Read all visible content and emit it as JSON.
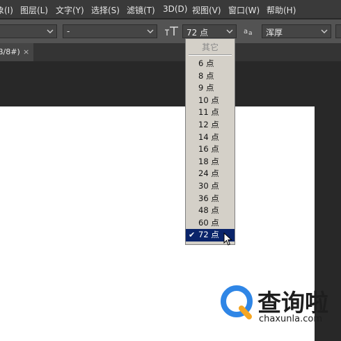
{
  "menubar": {
    "items": [
      "象(I)",
      "图层(L)",
      "文字(Y)",
      "选择(S)",
      "滤镜(T)",
      "3D(D)",
      "视图(V)",
      "窗口(W)",
      "帮助(H)"
    ]
  },
  "options_bar": {
    "font_style_value": "-",
    "font_size_icon": "font-size-icon",
    "font_size_value": "72 点",
    "antialias_icon": "aa-icon",
    "antialias_value": "浑厚"
  },
  "document_tab": {
    "title": "B/8#)",
    "close": "×"
  },
  "font_size_dropdown": {
    "header": "其它",
    "items": [
      "6 点",
      "8 点",
      "9 点",
      "10 点",
      "11 点",
      "12 点",
      "14 点",
      "16 点",
      "18 点",
      "24 点",
      "30 点",
      "36 点",
      "48 点",
      "60 点",
      "72 点"
    ],
    "selected": "72 点",
    "check": "✔"
  },
  "watermark": {
    "title": "查询啦",
    "url": "chaxunla.com"
  },
  "colors": {
    "menubar_bg": "#3a3a3a",
    "options_bg": "#535353",
    "workspace_bg": "#282828",
    "canvas_bg": "#ffffff",
    "dropdown_bg": "#d4d0c8",
    "selection_bg": "#0a246a",
    "logo_blue": "#2f86e6",
    "logo_orange": "#f5a623"
  }
}
